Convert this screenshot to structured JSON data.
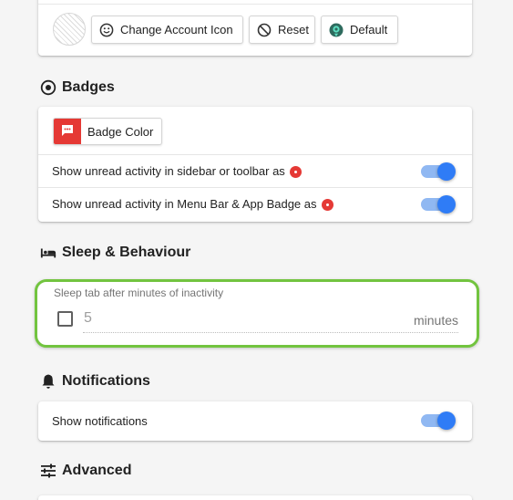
{
  "account": {
    "change_icon_label": "Change Account Icon",
    "reset_label": "Reset",
    "default_label": "Default"
  },
  "badges": {
    "title": "Badges",
    "badge_color_label": "Badge Color",
    "badge_color": "#e53935",
    "rows": [
      {
        "label": "Show unread activity in sidebar or toolbar as",
        "enabled": true
      },
      {
        "label": "Show unread activity in Menu Bar & App Badge as",
        "enabled": true
      }
    ]
  },
  "sleep": {
    "title": "Sleep & Behaviour",
    "field_label": "Sleep tab after minutes of inactivity",
    "checked": false,
    "value": "5",
    "unit": "minutes"
  },
  "notifications": {
    "title": "Notifications",
    "rows": [
      {
        "label": "Show notifications",
        "enabled": true
      }
    ]
  },
  "advanced": {
    "title": "Advanced"
  },
  "colors": {
    "toggle_on": "#2f7cf6",
    "toggle_track": "#90b8f2",
    "highlight": "#72c43f"
  },
  "icons": [
    "smiley-icon",
    "block-icon",
    "default-account-icon",
    "target-icon",
    "badge-chat-icon",
    "bed-icon",
    "bell-icon",
    "tune-icon"
  ]
}
